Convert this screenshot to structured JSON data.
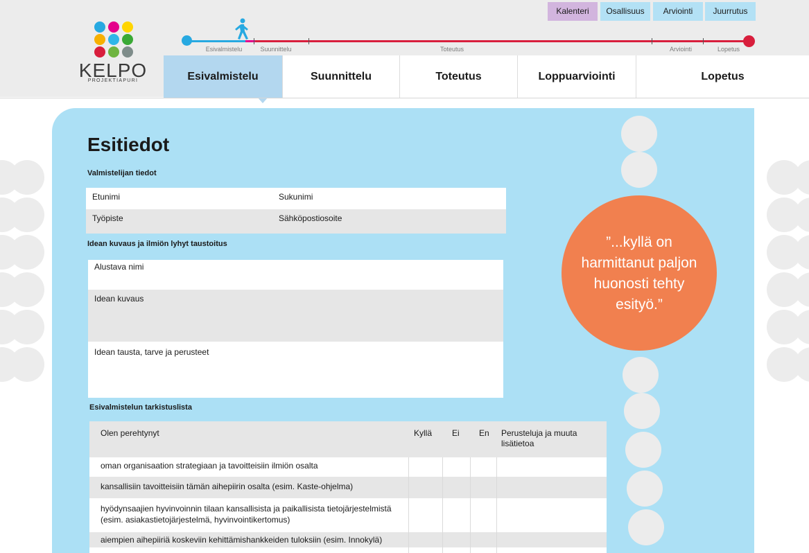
{
  "logo": {
    "name": "KELPO",
    "subtitle": "PROJEKTIAPURI"
  },
  "top_buttons": [
    {
      "label": "Kalenteri",
      "color": "#d2b5de"
    },
    {
      "label": "Osallisuus",
      "color": "#b3e1f5"
    },
    {
      "label": "Arviointi",
      "color": "#b3e1f5"
    },
    {
      "label": "Juurrutus",
      "color": "#b3e1f5"
    }
  ],
  "timeline_labels": [
    "Esivalmistelu",
    "Suunnittelu",
    "Toteutus",
    "Arviointi",
    "Lopetus"
  ],
  "nav": [
    {
      "label": "Esivalmistelu",
      "active": true
    },
    {
      "label": "Suunnittelu"
    },
    {
      "label": "Toteutus"
    },
    {
      "label": "Loppuarviointi"
    },
    {
      "label": "Lopetus"
    }
  ],
  "page_title": "Esitiedot",
  "preparer": {
    "heading": "Valmistelijan tiedot",
    "fields": [
      "Etunimi",
      "Sukunimi",
      "Työpiste",
      "Sähköpostiosoite"
    ]
  },
  "idea": {
    "heading": "Idean kuvaus ja ilmiön lyhyt taustoitus",
    "fields": [
      "Alustava nimi",
      "Idean kuvaus",
      "Idean tausta, tarve ja perusteet"
    ]
  },
  "checklist": {
    "heading": "Esivalmistelun tarkistuslista",
    "headers": [
      "Olen perehtynyt",
      "Kyllä",
      "Ei",
      "En",
      "Perusteluja ja muuta lisätietoa"
    ],
    "rows": [
      "oman organisaation strategiaan ja tavoitteisiin ilmiön osalta",
      "kansallisiin tavoitteisiin tämän aihepiirin osalta (esim. Kaste-ohjelma)",
      "hyödynsaajien hyvinvoinnin tilaan kansallisista ja paikallisista tietojärjestelmistä (esim. asiakastietojärjestelmä, hyvinvointikertomus)",
      "aiempien aihepiiriä koskeviin kehittämishankkeiden tuloksiin (esim. Innokylä)"
    ]
  },
  "quote": "”...kyllä on harmittanut paljon huonosti tehty esityö.”",
  "colors": {
    "accent_blue": "#ace0f5",
    "quote_orange": "#f1804f",
    "timeline_red": "#d81e3c",
    "timeline_blue": "#27a9e1"
  }
}
